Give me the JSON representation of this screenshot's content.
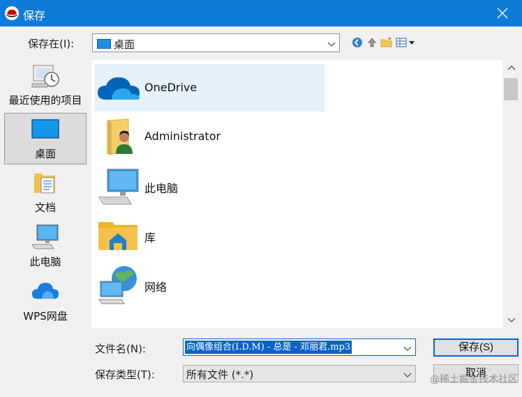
{
  "window": {
    "title": "保存"
  },
  "save_in": {
    "label": "保存在(I):",
    "value": "桌面"
  },
  "toolbar": {
    "back_icon": "back-icon",
    "up_icon": "up-folder-icon",
    "new_folder_icon": "new-folder-icon",
    "view_menu_icon": "view-menu-icon"
  },
  "places": [
    {
      "label": "最近使用的项目",
      "icon": "recent-items-icon"
    },
    {
      "label": "桌面",
      "icon": "desktop-icon"
    },
    {
      "label": "文档",
      "icon": "documents-icon"
    },
    {
      "label": "此电脑",
      "icon": "this-pc-icon"
    },
    {
      "label": "WPS网盘",
      "icon": "wps-cloud-icon"
    }
  ],
  "files": [
    {
      "label": "OneDrive",
      "icon": "onedrive-icon"
    },
    {
      "label": "Administrator",
      "icon": "user-folder-icon"
    },
    {
      "label": "此电脑",
      "icon": "this-pc-icon"
    },
    {
      "label": "库",
      "icon": "library-icon"
    },
    {
      "label": "网络",
      "icon": "network-icon"
    }
  ],
  "filename": {
    "label": "文件名(N):",
    "value": "向偶像组合(I.D.M) - 总是 - 邓丽君.mp3"
  },
  "filetype": {
    "label": "保存类型(T):",
    "value": "所有文件 (*.*)"
  },
  "buttons": {
    "save": "保存(S)",
    "cancel": "取消"
  },
  "watermark": "@稀土掘金技术社区",
  "colors": {
    "titlebar": "#0f7bd8",
    "selection": "#0a64c8",
    "highlight": "#e5f1fb"
  }
}
